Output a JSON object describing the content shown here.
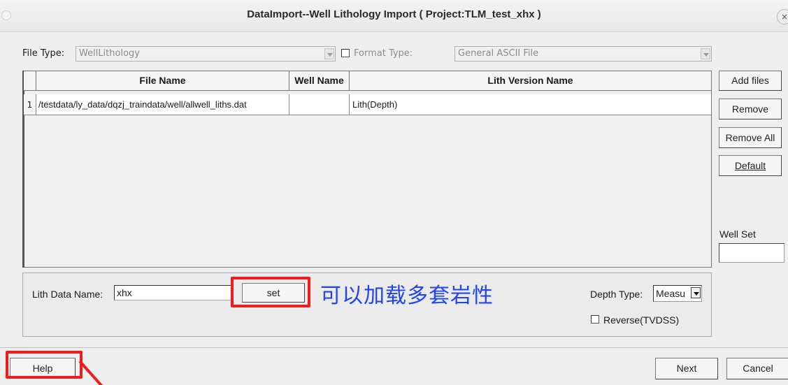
{
  "window": {
    "title": "DataImport--Well Lithology Import ( Project:TLM_test_xhx )",
    "close_icon": "×"
  },
  "file_type": {
    "label": "File Type:",
    "value": "WellLithology",
    "format_type_label": "Format Type:",
    "format_type_checked": false,
    "format_value": "General ASCII File"
  },
  "table": {
    "columns": [
      "File Name",
      "Well Name",
      "Lith Version Name"
    ],
    "rows": [
      {
        "index": "1",
        "file_name": "/testdata/ly_data/dqzj_traindata/well/allwell_liths.dat",
        "well_name": "",
        "lith_version": "Lith(Depth)"
      }
    ]
  },
  "side_buttons": {
    "add_files": "Add files",
    "remove": "Remove",
    "remove_all": "Remove All",
    "default": "Default",
    "well_set_label": "Well Set",
    "well_set_value": ""
  },
  "lith_group": {
    "lith_data_label": "Lith Data Name:",
    "lith_data_value": "xhx",
    "set_button": "set",
    "annotation": "可以加载多套岩性",
    "depth_type_label": "Depth Type:",
    "depth_type_value": "Measu",
    "reverse_label": "Reverse(TVDSS)",
    "reverse_checked": false
  },
  "footer": {
    "help": "Help",
    "next": "Next",
    "cancel": "Cancel"
  },
  "colors": {
    "highlight": "#ee1c1c",
    "annotation": "#2244ee"
  }
}
